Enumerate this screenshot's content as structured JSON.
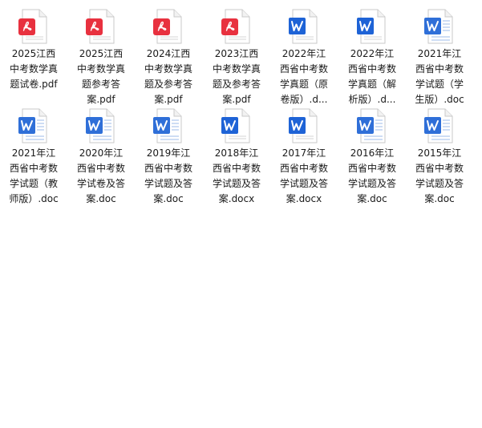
{
  "files": [
    {
      "type": "pdf",
      "icon": "pdf-file-icon",
      "line1": "2025江西",
      "line2": "中考数学真",
      "line3": "题试卷.pdf"
    },
    {
      "type": "pdf",
      "icon": "pdf-file-icon",
      "line1": "2025江西",
      "line2": "中考数学真",
      "line3": "题参考答",
      "line4": "案.pdf"
    },
    {
      "type": "pdf",
      "icon": "pdf-file-icon",
      "line1": "2024江西",
      "line2": "中考数学真",
      "line3": "题及参考答",
      "line4": "案.pdf"
    },
    {
      "type": "pdf",
      "icon": "pdf-file-icon",
      "line1": "2023江西",
      "line2": "中考数学真",
      "line3": "题及参考答",
      "line4": "案.pdf"
    },
    {
      "type": "docx",
      "icon": "word-file-icon",
      "line1": "2022年江",
      "line2": "西省中考数",
      "line3": "学真题（原",
      "line4": "卷版）.d..."
    },
    {
      "type": "docx",
      "icon": "word-file-icon",
      "line1": "2022年江",
      "line2": "西省中考数",
      "line3": "学真题（解",
      "line4": "析版）.d..."
    },
    {
      "type": "doc",
      "icon": "word-doc-file-icon",
      "line1": "2021年江",
      "line2": "西省中考数",
      "line3": "学试题（学",
      "line4": "生版）.doc"
    },
    {
      "type": "doc",
      "icon": "word-doc-file-icon",
      "line1": "2021年江",
      "line2": "西省中考数",
      "line3": "学试题（教",
      "line4": "师版）.doc"
    },
    {
      "type": "doc",
      "icon": "word-doc-file-icon",
      "line1": "2020年江",
      "line2": "西省中考数",
      "line3": "学试卷及答",
      "line4": "案.doc"
    },
    {
      "type": "doc",
      "icon": "word-doc-file-icon",
      "line1": "2019年江",
      "line2": "西省中考数",
      "line3": "学试题及答",
      "line4": "案.doc"
    },
    {
      "type": "docx",
      "icon": "word-file-icon",
      "line1": "2018年江",
      "line2": "西省中考数",
      "line3": "学试题及答",
      "line4": "案.docx"
    },
    {
      "type": "docx",
      "icon": "word-file-icon",
      "line1": "2017年江",
      "line2": "西省中考数",
      "line3": "学试题及答",
      "line4": "案.docx"
    },
    {
      "type": "doc",
      "icon": "word-doc-file-icon",
      "line1": "2016年江",
      "line2": "西省中考数",
      "line3": "学试题及答",
      "line4": "案.doc"
    },
    {
      "type": "doc",
      "icon": "word-doc-file-icon",
      "line1": "2015年江",
      "line2": "西省中考数",
      "line3": "学试题及答",
      "line4": "案.doc"
    }
  ],
  "colors": {
    "pdf_red": "#e8313f",
    "word_blue": "#1e63d6",
    "doc_blue": "#2f6fd8",
    "page_fill": "#ffffff",
    "page_border": "#c9c9c9",
    "text": "#1a1a1a"
  }
}
